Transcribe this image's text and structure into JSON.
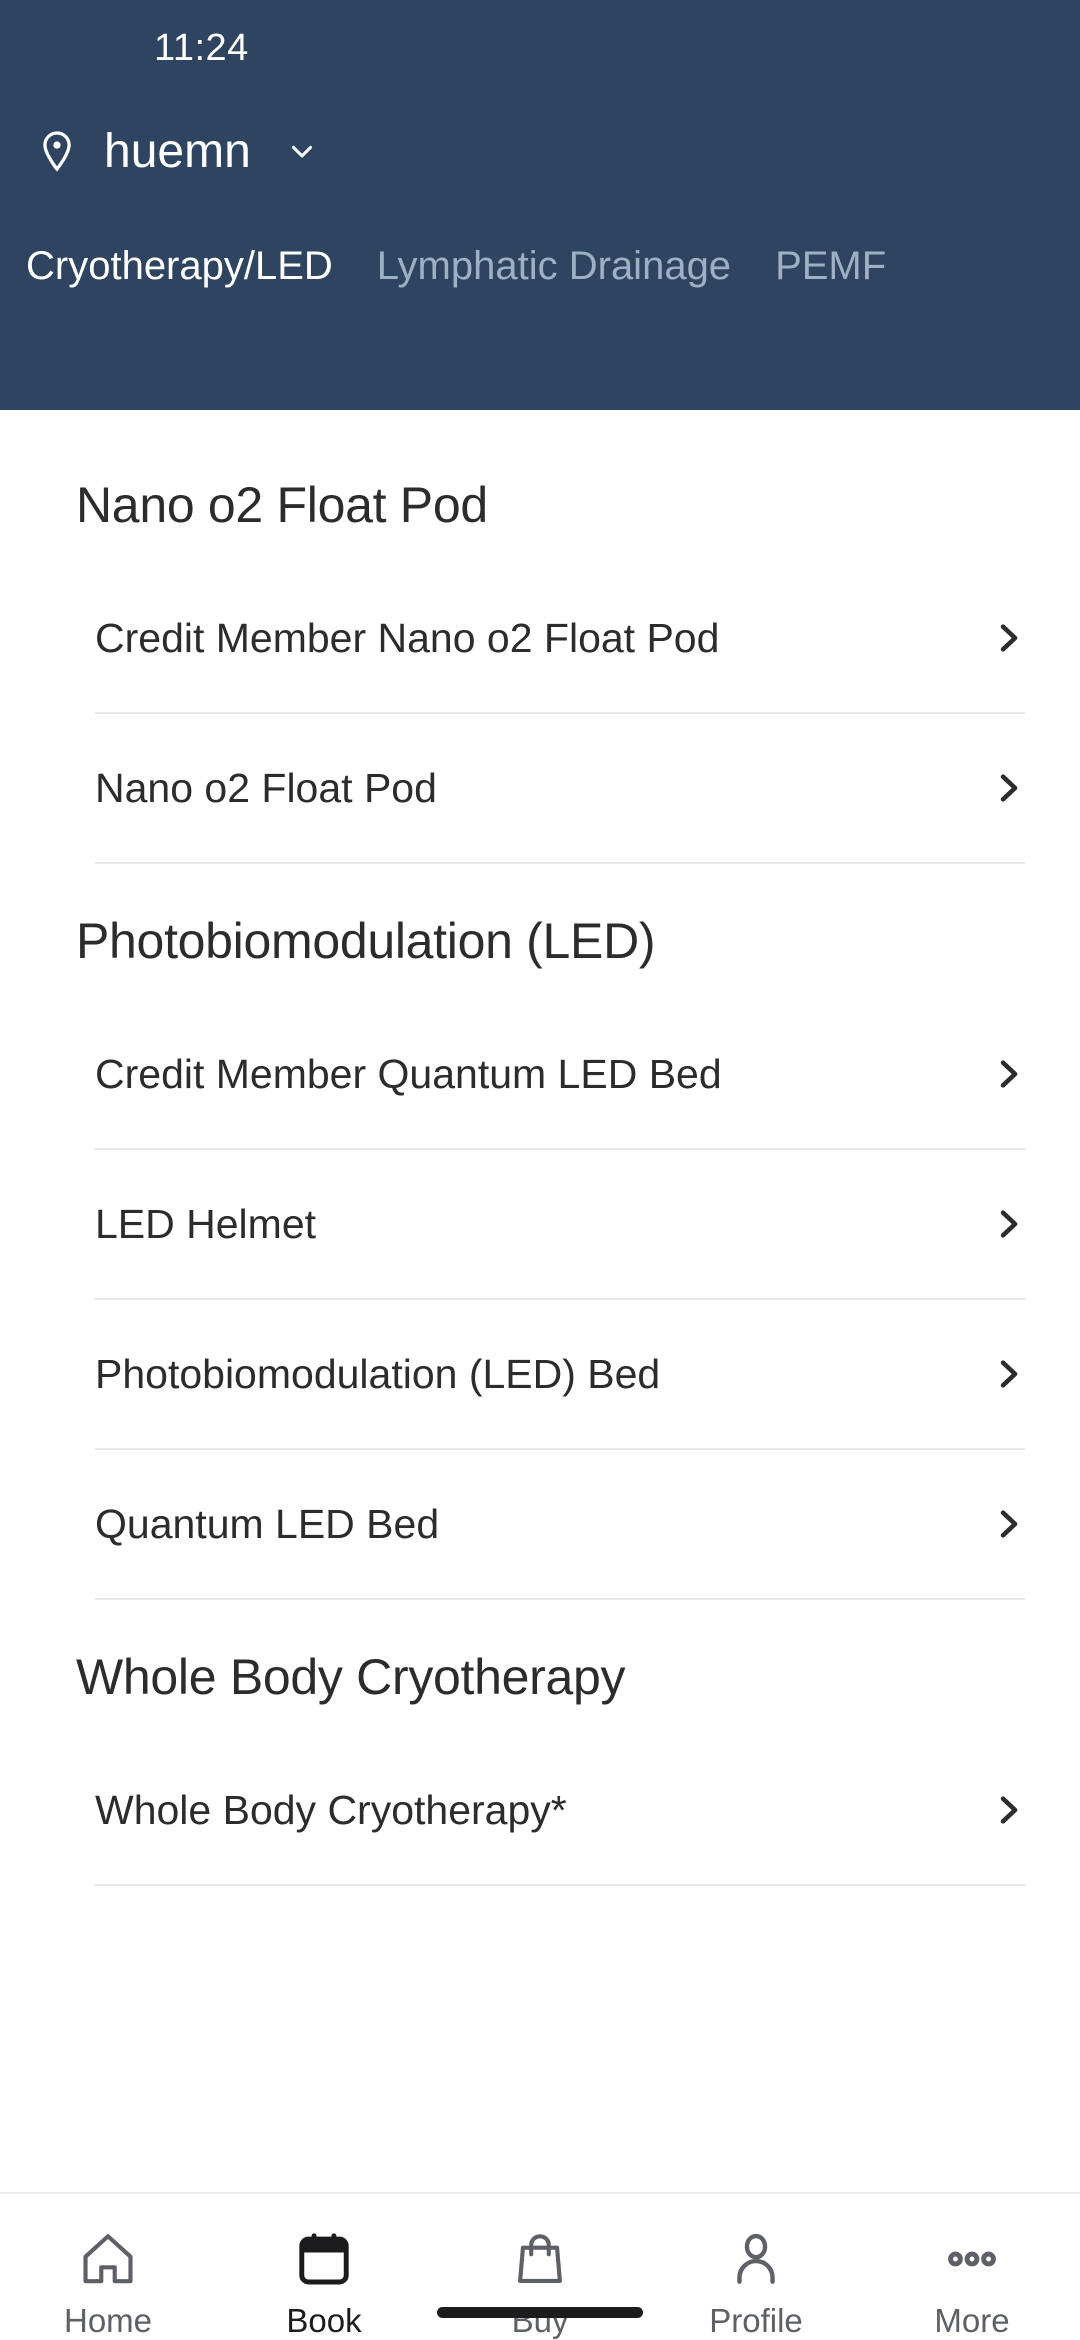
{
  "status_bar": {
    "time": "11:24"
  },
  "header": {
    "pin_icon": "location-pin-icon",
    "location_name": "huemn",
    "chevron_icon": "chevron-down-icon",
    "background_color": "#2e4460",
    "tabs": [
      {
        "label": "Cryotherapy/LED",
        "active": true
      },
      {
        "label": "Lymphatic Drainage",
        "active": false
      },
      {
        "label": "PEMF",
        "active": false
      }
    ]
  },
  "main": {
    "sections": [
      {
        "title": "Nano o2 Float Pod",
        "items": [
          {
            "label": "Credit Member Nano o2 Float Pod",
            "chevron": "chevron-right-icon"
          },
          {
            "label": "Nano o2 Float Pod",
            "chevron": "chevron-right-icon"
          }
        ]
      },
      {
        "title": "Photobiomodulation (LED)",
        "items": [
          {
            "label": "Credit Member Quantum LED Bed",
            "chevron": "chevron-right-icon"
          },
          {
            "label": "LED Helmet",
            "chevron": "chevron-right-icon"
          },
          {
            "label": "Photobiomodulation (LED) Bed",
            "chevron": "chevron-right-icon"
          },
          {
            "label": "Quantum LED Bed",
            "chevron": "chevron-right-icon"
          }
        ]
      },
      {
        "title": "Whole Body Cryotherapy",
        "items": [
          {
            "label": "Whole Body Cryotherapy*",
            "chevron": "chevron-right-icon"
          }
        ]
      }
    ]
  },
  "bottom_nav": {
    "items": [
      {
        "label": "Home",
        "icon": "home-icon",
        "active": false
      },
      {
        "label": "Book",
        "icon": "calendar-icon",
        "active": true
      },
      {
        "label": "Buy",
        "icon": "shopping-bag-icon",
        "active": false
      },
      {
        "label": "Profile",
        "icon": "person-icon",
        "active": false
      },
      {
        "label": "More",
        "icon": "ellipsis-icon",
        "active": false
      }
    ]
  }
}
